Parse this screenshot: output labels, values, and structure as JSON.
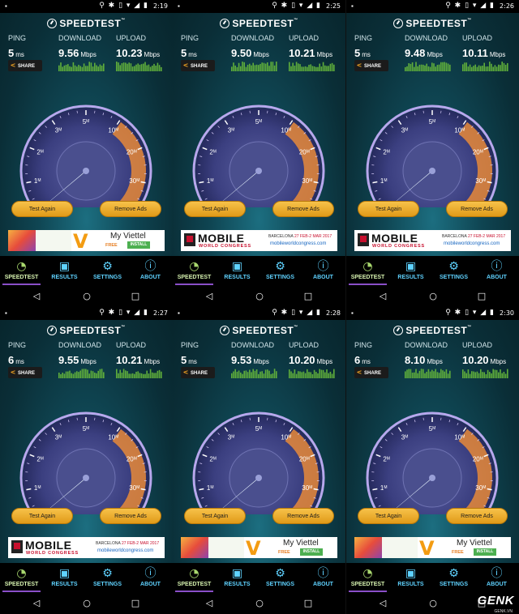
{
  "app_name": "SPEEDTEST",
  "labels": {
    "ping": "PING",
    "download": "DOWNLOAD",
    "upload": "UPLOAD"
  },
  "units": {
    "ping": "ms",
    "speed": "Mbps"
  },
  "share_label": "SHARE",
  "buttons": {
    "test_again": "Test Again",
    "remove_ads": "Remove Ads"
  },
  "tabs": [
    {
      "label": "SPEEDTEST",
      "icon": "gauge-icon"
    },
    {
      "label": "RESULTS",
      "icon": "results-icon"
    },
    {
      "label": "SETTINGS",
      "icon": "gear-icon"
    },
    {
      "label": "ABOUT",
      "icon": "info-icon"
    }
  ],
  "gauge_ticks": [
    "0",
    "1",
    "2",
    "3",
    "5",
    "10",
    "20",
    "30",
    "50"
  ],
  "gauge_tick_unit": "M",
  "colors": {
    "accent_green": "#a9d86e",
    "accent_blue": "#5fd2ff",
    "tab_underline": "#8a4fc8",
    "button_gold": "#f1b434",
    "gauge_orange": "#e8893a"
  },
  "ads": {
    "mwc": {
      "title": "MOBILE",
      "subtitle": "WORLD CONGRESS",
      "city": "BARCELONA",
      "dates": "27 FEB-2 MAR 2017",
      "url": "mobileworldcongress.com"
    },
    "viettel": {
      "title": "My Viettel",
      "free": "FREE",
      "install": "INSTALL"
    }
  },
  "watermark": {
    "text": "GENK",
    "sub": "GENK.VN"
  },
  "panels": [
    {
      "time": "2:19",
      "ping": "5",
      "download": "9.56",
      "upload": "10.23",
      "ad": "viettel"
    },
    {
      "time": "2:25",
      "ping": "5",
      "download": "9.50",
      "upload": "10.21",
      "ad": "mwc"
    },
    {
      "time": "2:26",
      "ping": "5",
      "download": "9.48",
      "upload": "10.11",
      "ad": "mwc"
    },
    {
      "time": "2:27",
      "ping": "6",
      "download": "9.55",
      "upload": "10.21",
      "ad": "mwc"
    },
    {
      "time": "2:28",
      "ping": "5",
      "download": "9.53",
      "upload": "10.20",
      "ad": "viettel"
    },
    {
      "time": "2:30",
      "ping": "6",
      "download": "8.10",
      "upload": "10.20",
      "ad": "viettel"
    }
  ]
}
